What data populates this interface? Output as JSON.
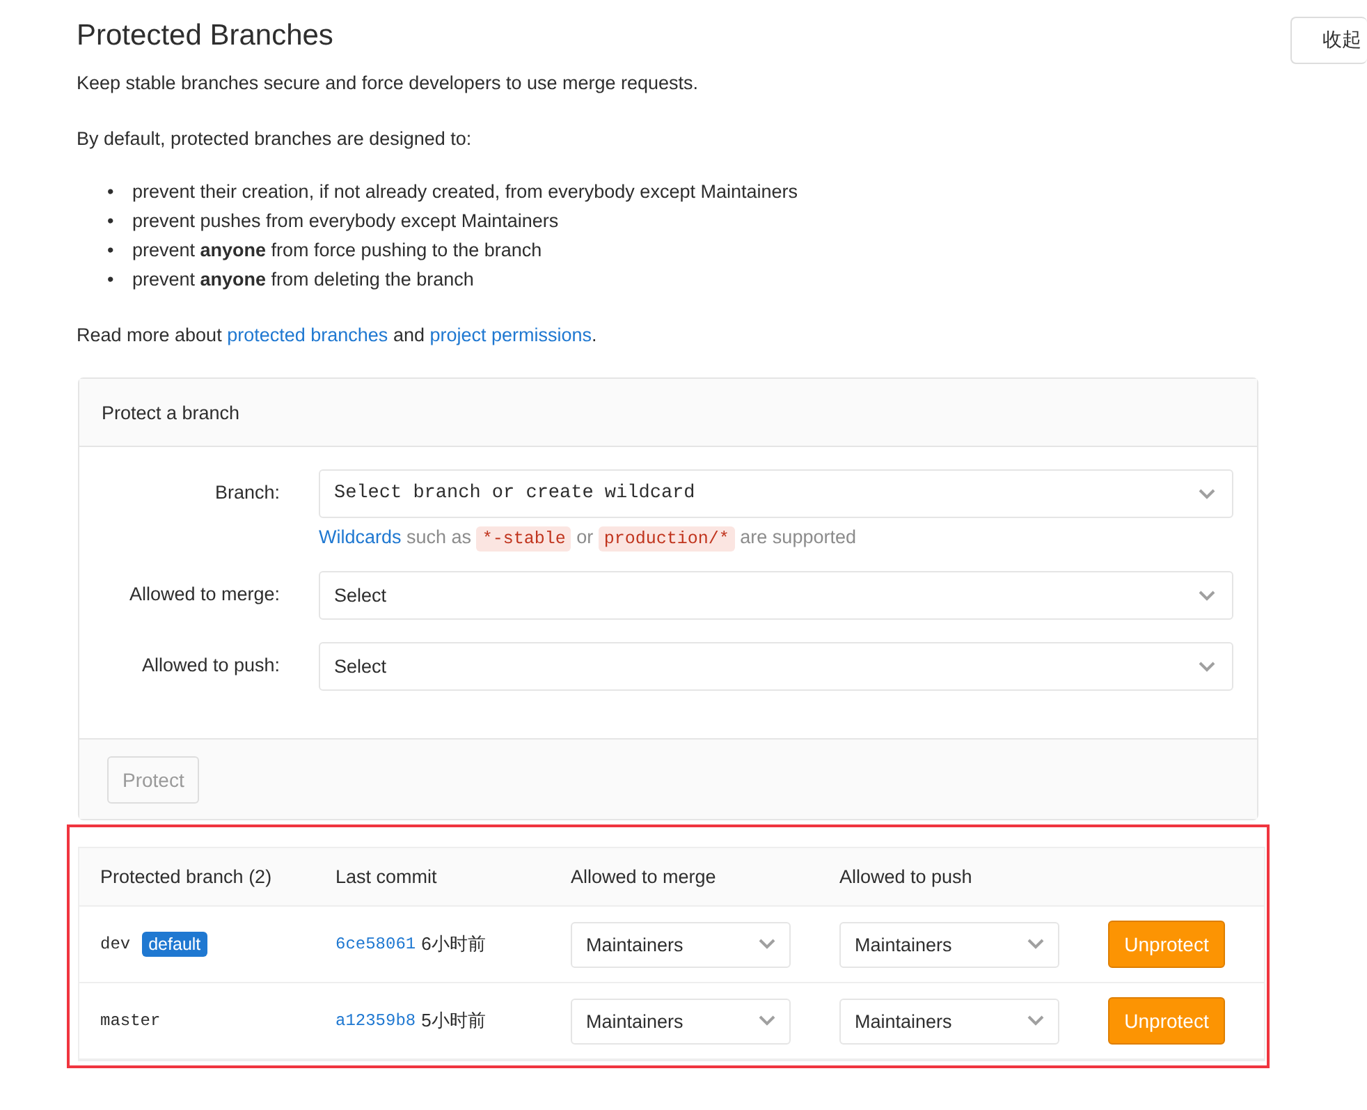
{
  "page_title": "Protected Branches",
  "intro": "Keep stable branches secure and force developers to use merge requests.",
  "defaults_heading": "By default, protected branches are designed to:",
  "rules": [
    {
      "marker": "•",
      "text": "prevent their creation, if not already created, from everybody except Maintainers"
    },
    {
      "marker": "•",
      "text": "prevent pushes from everybody except Maintainers"
    },
    {
      "marker": "•",
      "text": "prevent **anyone** from force pushing to the branch"
    },
    {
      "marker": "•",
      "text": "prevent **anyone** from deleting the branch"
    }
  ],
  "read_more": {
    "prefix": "Read more about",
    "link_1": "protected branches",
    "middle": "and",
    "link_2": "project permissions",
    "suffix": "."
  },
  "collapse_button": "收起",
  "protect_form": {
    "title": "Protect a branch",
    "fields": [
      {
        "kind": "branch",
        "label": "Branch:",
        "value": "Select branch or create wildcard"
      },
      {
        "kind": "select",
        "label": "Allowed to merge:",
        "value": "Select"
      },
      {
        "kind": "select",
        "label": "Allowed to push:",
        "value": "Select"
      }
    ],
    "hint": {
      "link": "Wildcards",
      "text_1": "such as",
      "code_1": "*-stable",
      "text_2": "or",
      "code_2": "production/*",
      "text_3": "are supported"
    },
    "submit": {
      "label": "Protect",
      "disabled": true
    }
  },
  "protected_table": {
    "columns": [
      "Protected branch (2)",
      "Last commit",
      "Allowed to merge",
      "Allowed to push"
    ],
    "rows": [
      {
        "branch": "dev",
        "badge": "default",
        "commit": "6ce58061",
        "time": "6小时前",
        "merge": "Maintainers",
        "push": "Maintainers",
        "action": "Unprotect"
      },
      {
        "branch": "master",
        "commit": "a12359b8",
        "time": "5小时前",
        "merge": "Maintainers",
        "push": "Maintainers",
        "action": "Unprotect"
      }
    ]
  }
}
